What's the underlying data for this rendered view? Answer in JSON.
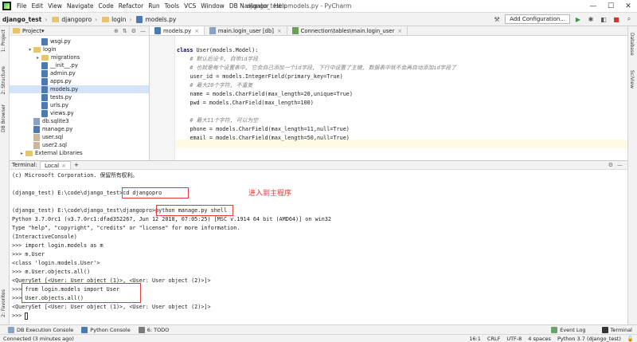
{
  "window": {
    "project_name": "django_test",
    "title": "django_test - models.py - PyCharm",
    "minimize": "—",
    "maximize": "☐",
    "close": "✕"
  },
  "menu": [
    "File",
    "Edit",
    "View",
    "Navigate",
    "Code",
    "Refactor",
    "Run",
    "Tools",
    "VCS",
    "Window",
    "DB Navigator",
    "Help"
  ],
  "breadcrumb": [
    "django_test",
    "djangopro",
    "login",
    "models.py"
  ],
  "toolbar": {
    "add_config": "Add Configuration..."
  },
  "left_strip": [
    "1: Project",
    "2: Structure",
    "DB Browser",
    "2: Favorites"
  ],
  "right_strip": [
    "Database",
    "SciView"
  ],
  "project_panel": {
    "header": "Project",
    "nodes": [
      {
        "label": "wsgi.py",
        "type": "py",
        "indent": 2
      },
      {
        "label": "login",
        "type": "folder",
        "indent": 1,
        "arrow": "▾"
      },
      {
        "label": "migrations",
        "type": "folder",
        "indent": 2,
        "arrow": "▸"
      },
      {
        "label": "__init__.py",
        "type": "py",
        "indent": 2
      },
      {
        "label": "admin.py",
        "type": "py",
        "indent": 2
      },
      {
        "label": "apps.py",
        "type": "py",
        "indent": 2
      },
      {
        "label": "models.py",
        "type": "py",
        "indent": 2,
        "selected": true
      },
      {
        "label": "tests.py",
        "type": "py",
        "indent": 2
      },
      {
        "label": "urls.py",
        "type": "py",
        "indent": 2
      },
      {
        "label": "views.py",
        "type": "py",
        "indent": 2
      },
      {
        "label": "db.sqlite3",
        "type": "db",
        "indent": 1
      },
      {
        "label": "manage.py",
        "type": "py",
        "indent": 1
      },
      {
        "label": "user.sql",
        "type": "sql",
        "indent": 1
      },
      {
        "label": "user2.sql",
        "type": "sql",
        "indent": 1
      },
      {
        "label": "External Libraries",
        "type": "folder",
        "indent": 0,
        "arrow": "▸"
      }
    ]
  },
  "editor": {
    "tabs": [
      "models.py",
      "main.login_user [db]",
      "Connection\\tables\\main.login_user"
    ],
    "code": [
      "",
      "class User(models.Model):",
      "    # 默认后设卡, 自带id字段",
      "    # 也就是每个设置表中, 它会自己添加一个id字段, 下行中设置了主键, 数据表中就不会再自动添加id字段了",
      "    user_id = models.IntegerField(primary_key=True)",
      "    # 最大20个字符, 不重复",
      "    name = models.CharField(max_length=20,unique=True)",
      "    pwd = models.CharField(max_length=100)",
      "",
      "    # 最大11个字符, 可以为空",
      "    phone = models.CharField(max_length=11,null=True)",
      "    email = models.CharField(max_length=50,null=True)",
      ""
    ]
  },
  "terminal": {
    "label": "Terminal:",
    "tab": "Local",
    "annotation": "进入到主程序",
    "lines": [
      "(c) Microsoft Corporation. 保留所有权利。",
      "",
      "(django_test) E:\\code\\django_test>cd djangopro",
      "",
      "(django_test) E:\\code\\django_test\\djangopro>python manage.py shell",
      "Python 3.7.0rc1 (v3.7.0rc1:dfad352267, Jun 12 2018, 07:05:25) [MSC v.1914 64 bit (AMD64)] on win32",
      "Type \"help\", \"copyright\", \"credits\" or \"license\" for more information.",
      "(InteractiveConsole)",
      ">>> import login.models as m",
      ">>> m.User",
      "<class 'login.models.User'>",
      ">>> m.User.objects.all()",
      "<QuerySet [<User: User object (1)>, <User: User object (2)>]>",
      ">>> from login.models import User",
      ">>> User.objects.all()",
      "<QuerySet [<User: User object (1)>, <User: User object (2)>]>",
      ">>> "
    ]
  },
  "bottom_tools": [
    "DB Execution Console",
    "Python Console",
    "6: TODO"
  ],
  "bottom_right": [
    "Event Log",
    "Terminal"
  ],
  "status": {
    "message": "Connected (3 minutes ago)",
    "position": "16:1",
    "line_sep": "CRLF",
    "encoding": "UTF-8",
    "indent": "4 spaces",
    "interpreter": "Python 3.7 (django_test)"
  },
  "colors": {
    "highlight_box": "#e53935",
    "annotation": "#e53935",
    "selection": "#d5e3f8"
  }
}
